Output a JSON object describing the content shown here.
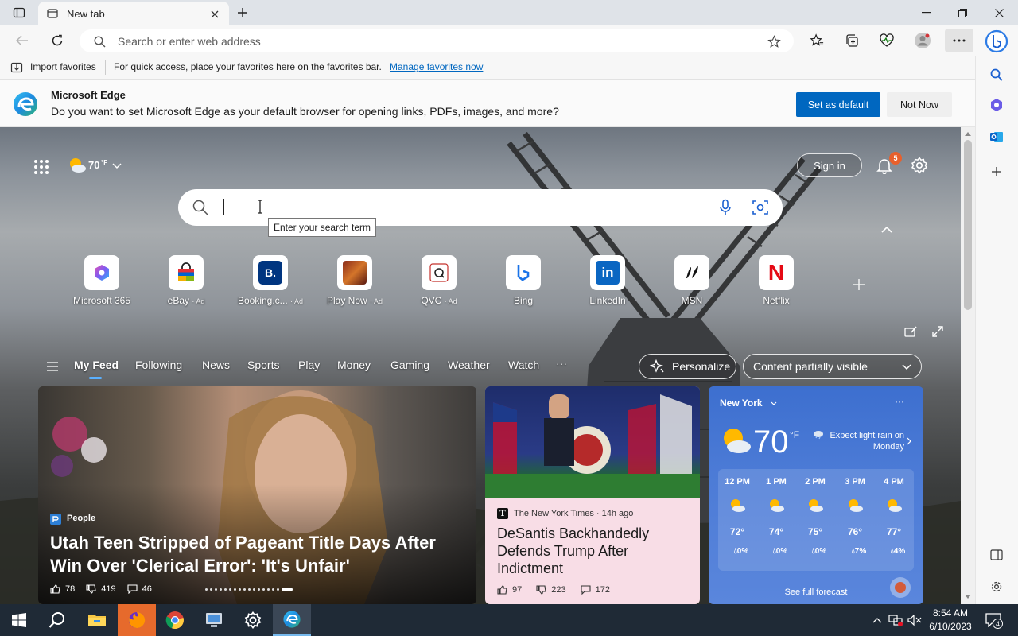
{
  "tab": {
    "title": "New tab"
  },
  "address": {
    "placeholder": "Search or enter web address"
  },
  "favbar": {
    "import_label": "Import favorites",
    "hint": "For quick access, place your favorites here on the favorites bar.",
    "manage_link": "Manage favorites now"
  },
  "infobar": {
    "title": "Microsoft Edge",
    "message": "Do you want to set Microsoft Edge as your default browser for opening links, PDFs, images, and more?",
    "set_default": "Set as default",
    "not_now": "Not Now"
  },
  "header": {
    "weather_temp": "70",
    "weather_unit": "°F",
    "sign_in": "Sign in",
    "notif_count": "5"
  },
  "search": {
    "tooltip": "Enter your search term"
  },
  "tiles": [
    {
      "label": "Microsoft 365",
      "ad": ""
    },
    {
      "label": "eBay",
      "ad": "· Ad"
    },
    {
      "label": "Booking.c...",
      "ad": "· Ad"
    },
    {
      "label": "Play Now",
      "ad": "· Ad"
    },
    {
      "label": "QVC",
      "ad": "· Ad"
    },
    {
      "label": "Bing",
      "ad": ""
    },
    {
      "label": "LinkedIn",
      "ad": ""
    },
    {
      "label": "MSN",
      "ad": ""
    },
    {
      "label": "Netflix",
      "ad": ""
    }
  ],
  "tile_glyphs": {
    "booking": "B.",
    "linkedin": "in",
    "netflix": "N"
  },
  "feednav": {
    "items": [
      "My Feed",
      "Following",
      "News",
      "Sports",
      "Play",
      "Money",
      "Gaming",
      "Weather",
      "Watch"
    ],
    "more": "···",
    "personalize": "Personalize",
    "content_visibility": "Content partially visible"
  },
  "card1": {
    "source": "People",
    "headline": "Utah Teen Stripped of Pageant Title Days After Win Over 'Clerical Error': 'It's Unfair'",
    "likes": "78",
    "dislikes": "419",
    "comments": "46"
  },
  "card2": {
    "source": "The New York Times · 14h ago",
    "headline": "DeSantis Backhandedly Defends Trump After Indictment",
    "likes": "97",
    "dislikes": "223",
    "comments": "172"
  },
  "weather": {
    "city": "New York",
    "temp": "70",
    "unit": "°F",
    "forecast_note": "Expect light rain on Monday",
    "more": "···",
    "hours": [
      {
        "time": "12 PM",
        "temp": "72°",
        "precip": "0%"
      },
      {
        "time": "1 PM",
        "temp": "74°",
        "precip": "0%"
      },
      {
        "time": "2 PM",
        "temp": "75°",
        "precip": "0%"
      },
      {
        "time": "3 PM",
        "temp": "76°",
        "precip": "7%"
      },
      {
        "time": "4 PM",
        "temp": "77°",
        "precip": "4%"
      }
    ],
    "see_forecast": "See full forecast"
  },
  "taskbar": {
    "time": "8:54 AM",
    "date": "6/10/2023",
    "notif_count": "4"
  },
  "colors": {
    "accent": "#0067c0",
    "notif_badge": "#e8602c",
    "link": "#0067c0"
  }
}
